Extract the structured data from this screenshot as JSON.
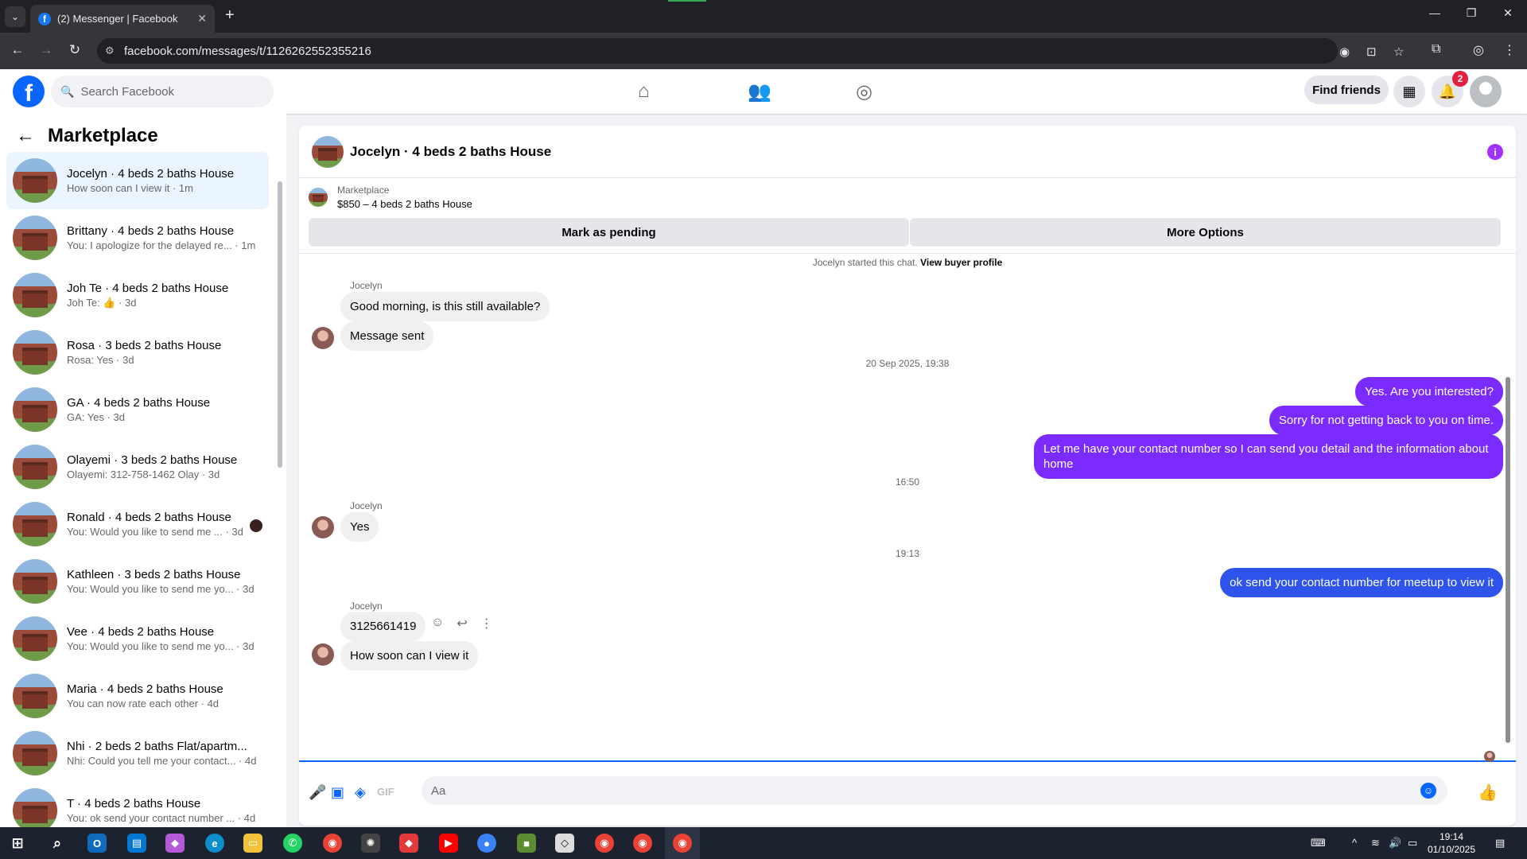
{
  "browser": {
    "tab_title": "(2) Messenger | Facebook",
    "url": "facebook.com/messages/t/1126262552355216"
  },
  "fb": {
    "search_placeholder": "Search Facebook",
    "find_friends": "Find friends",
    "notification_count": "2"
  },
  "sidebar": {
    "title": "Marketplace",
    "conversations": [
      {
        "name": "Jocelyn · 4 beds 2 baths House",
        "snippet": "How soon can I view it · 1m",
        "active": true
      },
      {
        "name": "Brittany · 4 beds 2 baths House",
        "snippet": "You: I apologize for the delayed re... · 1m"
      },
      {
        "name": "Joh Te · 4 beds 2 baths House",
        "snippet": "Joh Te: 👍 · 3d"
      },
      {
        "name": "Rosa · 3 beds 2 baths House",
        "snippet": "Rosa: Yes · 3d"
      },
      {
        "name": "GA · 4 beds 2 baths House",
        "snippet": "GA: Yes · 3d"
      },
      {
        "name": "Olayemi · 3 beds 2 baths House",
        "snippet": "Olayemi: 312-758-1462 Olay · 3d"
      },
      {
        "name": "Ronald · 4 beds 2 baths House",
        "snippet": "You: Would you like to send me ... · 3d"
      },
      {
        "name": "Kathleen · 3 beds 2 baths House",
        "snippet": "You: Would you like to send me yo... · 3d"
      },
      {
        "name": "Vee · 4 beds 2 baths House",
        "snippet": "You: Would you like to send me yo... · 3d"
      },
      {
        "name": "Maria · 4 beds 2 baths House",
        "snippet": "You can now rate each other · 4d"
      },
      {
        "name": "Nhi · 2 beds 2 baths Flat/apartm...",
        "snippet": "Nhi: Could you tell me your contact... · 4d"
      },
      {
        "name": "T · 4 beds 2 baths House",
        "snippet": "You: ok send your contact number ... · 4d"
      }
    ]
  },
  "chat": {
    "title": "Jocelyn · 4 beds 2 baths House",
    "listing_label": "Marketplace",
    "listing_price": "$850 – 4 beds 2 baths House",
    "mark_pending": "Mark as pending",
    "more_options": "More Options",
    "started_note": "Jocelyn started this chat.",
    "view_profile": "View buyer profile",
    "sender_name": "Jocelyn",
    "messages": {
      "m1": "Good morning, is this still available?",
      "m2": "Message sent",
      "ts1": "20 Sep 2025, 19:38",
      "m3": "Yes. Are you interested?",
      "m4": "Sorry for not getting back to you on time.",
      "m5": "Let me have your contact number so I can send you detail and the information about home",
      "ts2": "16:50",
      "m6": "Yes",
      "ts3": "19:13",
      "m7": "ok send your contact number for meetup to view it",
      "m8": "3125661419",
      "m9": "How soon can I view it"
    },
    "composer_placeholder": "Aa"
  },
  "taskbar": {
    "time": "19:14",
    "date": "01/10/2025"
  }
}
